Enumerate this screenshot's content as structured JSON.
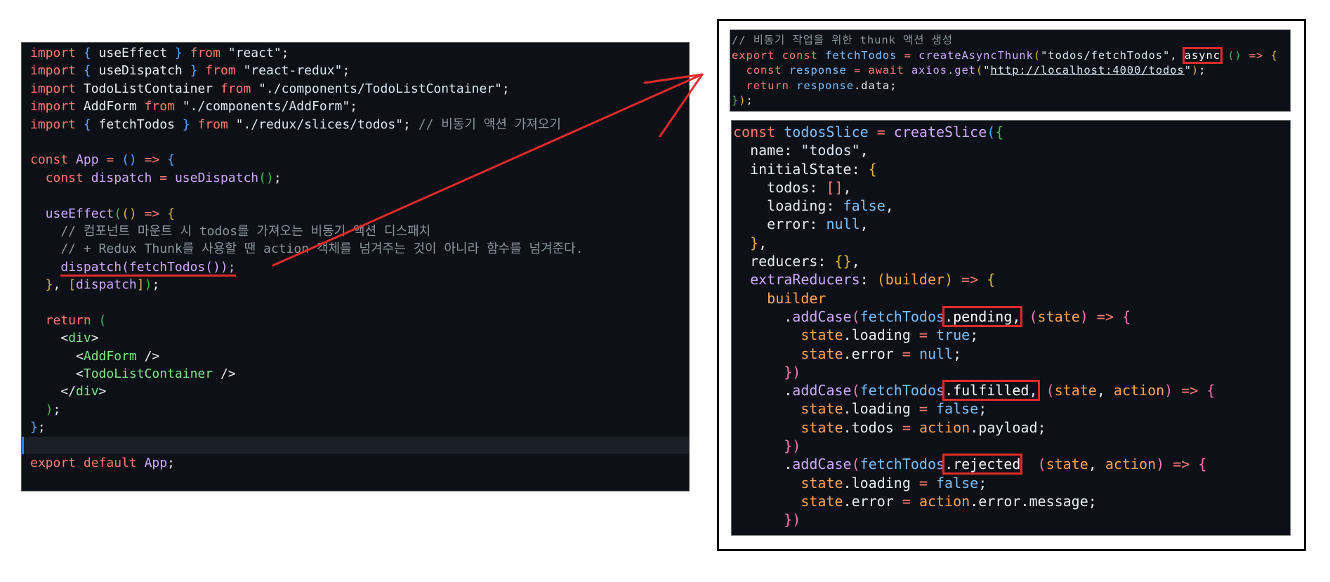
{
  "left_editor": {
    "lines": [
      [
        [
          "import",
          "k"
        ],
        [
          " { ",
          "b"
        ],
        [
          "useEffect",
          "p"
        ],
        [
          " } ",
          "b"
        ],
        [
          "from ",
          "k"
        ],
        [
          "\"react\"",
          "s"
        ],
        [
          ";",
          "p"
        ]
      ],
      [
        [
          "import",
          "k"
        ],
        [
          " { ",
          "b"
        ],
        [
          "useDispatch",
          "p"
        ],
        [
          " } ",
          "b"
        ],
        [
          "from ",
          "k"
        ],
        [
          "\"react-redux\"",
          "s"
        ],
        [
          ";",
          "p"
        ]
      ],
      [
        [
          "import ",
          "k"
        ],
        [
          "TodoListContainer ",
          "p"
        ],
        [
          "from ",
          "k"
        ],
        [
          "\"./components/TodoListContainer\"",
          "s"
        ],
        [
          ";",
          "p"
        ]
      ],
      [
        [
          "import ",
          "k"
        ],
        [
          "AddForm ",
          "p"
        ],
        [
          "from ",
          "k"
        ],
        [
          "\"./components/AddForm\"",
          "s"
        ],
        [
          ";",
          "p"
        ]
      ],
      [
        [
          "import",
          "k"
        ],
        [
          " { ",
          "b"
        ],
        [
          "fetchTodos",
          "p"
        ],
        [
          " } ",
          "b"
        ],
        [
          "from ",
          "k"
        ],
        [
          "\"./redux/slices/todos\"",
          "s"
        ],
        [
          "; ",
          "p"
        ],
        [
          "// 비동기 액션 가져오기",
          "c"
        ]
      ],
      [],
      [
        [
          "const ",
          "k"
        ],
        [
          "App ",
          "f"
        ],
        [
          "= ",
          "k"
        ],
        [
          "() ",
          "b"
        ],
        [
          "=> ",
          "k"
        ],
        [
          "{",
          "b"
        ]
      ],
      [
        [
          "  const ",
          "k"
        ],
        [
          "dispatch ",
          "f"
        ],
        [
          "= ",
          "k"
        ],
        [
          "useDispatch",
          "f"
        ],
        [
          "()",
          "gr"
        ],
        [
          ";",
          "p"
        ]
      ],
      [],
      [
        [
          "  useEffect",
          "f"
        ],
        [
          "(",
          "gr"
        ],
        [
          "() ",
          "y"
        ],
        [
          "=> ",
          "k"
        ],
        [
          "{",
          "y"
        ]
      ],
      [
        [
          "    // 컴포넌트 마운트 시 todos를 가져오는 비동기 액션 디스패치",
          "c"
        ]
      ],
      [
        [
          "    // + Redux Thunk를 사용할 땐 action 객체를 넘겨주는 것이 아니라 함수를 넘겨준다.",
          "c"
        ]
      ],
      [
        [
          "    ",
          "p"
        ],
        [
          "dispatch(fetchTodos());",
          "f",
          "uline"
        ]
      ],
      [
        [
          "  }",
          "y"
        ],
        [
          ", ",
          "p"
        ],
        [
          "[",
          "y"
        ],
        [
          "dispatch",
          "f"
        ],
        [
          "]",
          "y"
        ],
        [
          ")",
          "gr"
        ],
        [
          ";",
          "p"
        ]
      ],
      [],
      [
        [
          "  return ",
          "k"
        ],
        [
          "(",
          "gr"
        ]
      ],
      [
        [
          "    <",
          "p"
        ],
        [
          "div",
          "g"
        ],
        [
          ">",
          "p"
        ]
      ],
      [
        [
          "      <",
          "p"
        ],
        [
          "AddForm ",
          "g"
        ],
        [
          "/>",
          "p"
        ]
      ],
      [
        [
          "      <",
          "p"
        ],
        [
          "TodoListContainer ",
          "g"
        ],
        [
          "/>",
          "p"
        ]
      ],
      [
        [
          "    </",
          "p"
        ],
        [
          "div",
          "g"
        ],
        [
          ">",
          "p"
        ]
      ],
      [
        [
          "  )",
          "gr"
        ],
        [
          ";",
          "p"
        ]
      ],
      [
        [
          "}",
          "b"
        ],
        [
          ";",
          "p"
        ]
      ],
      [],
      [
        [
          "export ",
          "k"
        ],
        [
          "default ",
          "k"
        ],
        [
          "App",
          "f"
        ],
        [
          ";",
          "p"
        ]
      ]
    ],
    "current_line": 22
  },
  "thunk_snippet": {
    "lines": [
      [
        [
          "// 비동기 작업을 위한 thunk 액션 생성",
          "c"
        ]
      ],
      [
        [
          "export ",
          "k"
        ],
        [
          "const ",
          "k"
        ],
        [
          "fetchTodos ",
          "v"
        ],
        [
          "= ",
          "k"
        ],
        [
          "createAsyncThunk",
          "f"
        ],
        [
          "(",
          "y"
        ],
        [
          "\"todos/fetchTodos\"",
          "s"
        ],
        [
          ", ",
          "p"
        ],
        [
          "async",
          "k",
          "box"
        ],
        [
          " ",
          "p"
        ],
        [
          "()",
          "gr"
        ],
        [
          " => ",
          "k"
        ],
        [
          "{",
          "y"
        ]
      ],
      [
        [
          "  const ",
          "k"
        ],
        [
          "response ",
          "v"
        ],
        [
          "= ",
          "k"
        ],
        [
          "await ",
          "k"
        ],
        [
          "axios.get",
          "f"
        ],
        [
          "(",
          "y"
        ],
        [
          "\"",
          "s"
        ],
        [
          "http://localhost:4000/todos",
          "u"
        ],
        [
          "\"",
          "s"
        ],
        [
          ")",
          "y"
        ],
        [
          ";",
          "p"
        ]
      ],
      [
        [
          "  return ",
          "k"
        ],
        [
          "response",
          "v"
        ],
        [
          ".data;",
          "p"
        ]
      ],
      [
        [
          "}",
          "gr"
        ],
        [
          ")",
          "y"
        ],
        [
          ";",
          "p"
        ]
      ]
    ]
  },
  "slice_snippet": {
    "lines": [
      [
        [
          "const ",
          "k"
        ],
        [
          "todosSlice ",
          "v"
        ],
        [
          "= ",
          "k"
        ],
        [
          "createSlice",
          "f"
        ],
        [
          "(",
          "b"
        ],
        [
          "{",
          "gr"
        ]
      ],
      [
        [
          "  name: ",
          "p"
        ],
        [
          "\"todos\"",
          "s"
        ],
        [
          ",",
          "p"
        ]
      ],
      [
        [
          "  initialState: ",
          "p"
        ],
        [
          "{",
          "y"
        ]
      ],
      [
        [
          "    todos: ",
          "p"
        ],
        [
          "[]",
          "k"
        ],
        [
          ",",
          "p"
        ]
      ],
      [
        [
          "    loading: ",
          "p"
        ],
        [
          "false",
          "v"
        ],
        [
          ",",
          "p"
        ]
      ],
      [
        [
          "    error: ",
          "p"
        ],
        [
          "null",
          "v"
        ],
        [
          ",",
          "p"
        ]
      ],
      [
        [
          "  }",
          "y"
        ],
        [
          ",",
          "p"
        ]
      ],
      [
        [
          "  reducers: ",
          "p"
        ],
        [
          "{}",
          "y"
        ],
        [
          ",",
          "p"
        ]
      ],
      [
        [
          "  extraReducers",
          "f"
        ],
        [
          ": ",
          "p"
        ],
        [
          "(",
          "y"
        ],
        [
          "builder",
          "o"
        ],
        [
          ") ",
          "y"
        ],
        [
          "=> ",
          "k"
        ],
        [
          "{",
          "y"
        ]
      ],
      [
        [
          "    builder",
          "o"
        ]
      ],
      [
        [
          "      .",
          "p"
        ],
        [
          "addCase",
          "f"
        ],
        [
          "(",
          "pk"
        ],
        [
          "fetchTodos",
          "v"
        ],
        [
          ".pending,",
          "p",
          "box"
        ],
        [
          " ",
          "p"
        ],
        [
          "(",
          "pk"
        ],
        [
          "state",
          "o"
        ],
        [
          ") ",
          "pk"
        ],
        [
          "=> ",
          "k"
        ],
        [
          "{",
          "pk"
        ]
      ],
      [
        [
          "        state",
          "o"
        ],
        [
          ".loading ",
          "p"
        ],
        [
          "= ",
          "k"
        ],
        [
          "true",
          "v"
        ],
        [
          ";",
          "p"
        ]
      ],
      [
        [
          "        state",
          "o"
        ],
        [
          ".error ",
          "p"
        ],
        [
          "= ",
          "k"
        ],
        [
          "null",
          "v"
        ],
        [
          ";",
          "p"
        ]
      ],
      [
        [
          "      })",
          "pk"
        ]
      ],
      [
        [
          "      .",
          "p"
        ],
        [
          "addCase",
          "f"
        ],
        [
          "(",
          "pk"
        ],
        [
          "fetchTodos",
          "v"
        ],
        [
          ".fulfilled,",
          "p",
          "box"
        ],
        [
          " ",
          "p"
        ],
        [
          "(",
          "pk"
        ],
        [
          "state",
          "o"
        ],
        [
          ", ",
          "p"
        ],
        [
          "action",
          "o"
        ],
        [
          ") ",
          "pk"
        ],
        [
          "=> ",
          "k"
        ],
        [
          "{",
          "pk"
        ]
      ],
      [
        [
          "        state",
          "o"
        ],
        [
          ".loading ",
          "p"
        ],
        [
          "= ",
          "k"
        ],
        [
          "false",
          "v"
        ],
        [
          ";",
          "p"
        ]
      ],
      [
        [
          "        state",
          "o"
        ],
        [
          ".todos ",
          "p"
        ],
        [
          "= ",
          "k"
        ],
        [
          "action",
          "o"
        ],
        [
          ".payload;",
          "p"
        ]
      ],
      [
        [
          "      })",
          "pk"
        ]
      ],
      [
        [
          "      .",
          "p"
        ],
        [
          "addCase",
          "f"
        ],
        [
          "(",
          "pk"
        ],
        [
          "fetchTodos",
          "v"
        ],
        [
          ".rejected",
          "p",
          "box"
        ],
        [
          "  ",
          "p"
        ],
        [
          "(",
          "pk"
        ],
        [
          "state",
          "o"
        ],
        [
          ", ",
          "p"
        ],
        [
          "action",
          "o"
        ],
        [
          ") ",
          "pk"
        ],
        [
          "=> ",
          "k"
        ],
        [
          "{",
          "pk"
        ]
      ],
      [
        [
          "        state",
          "o"
        ],
        [
          ".loading ",
          "p"
        ],
        [
          "= ",
          "k"
        ],
        [
          "false",
          "v"
        ],
        [
          ";",
          "p"
        ]
      ],
      [
        [
          "        state",
          "o"
        ],
        [
          ".error ",
          "p"
        ],
        [
          "= ",
          "k"
        ],
        [
          "action",
          "o"
        ],
        [
          ".error.message;",
          "p"
        ]
      ],
      [
        [
          "      })",
          "pk"
        ]
      ]
    ]
  },
  "annotation": {
    "color": "#e02b2b"
  }
}
